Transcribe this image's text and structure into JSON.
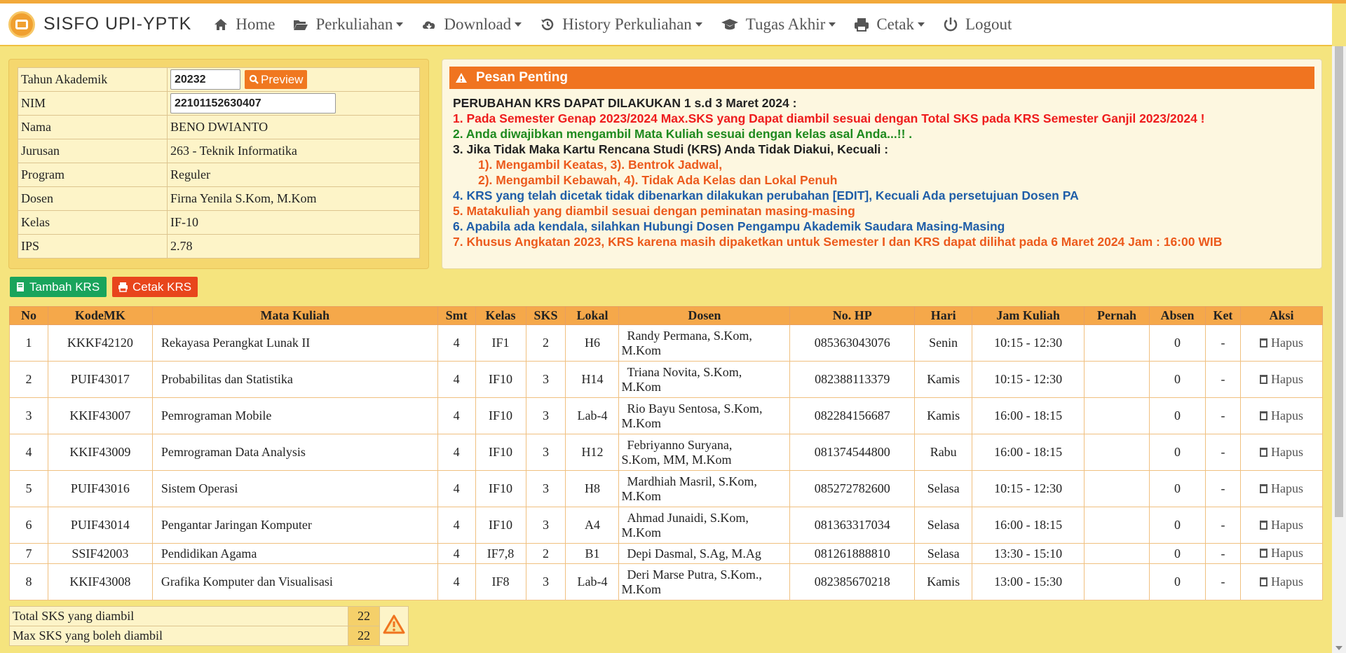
{
  "nav": {
    "brand": "SISFO UPI-YPTK",
    "items": [
      {
        "label": "Home",
        "icon": "home-icon",
        "dropdown": false
      },
      {
        "label": "Perkuliahan",
        "icon": "folder-open-icon",
        "dropdown": true
      },
      {
        "label": "Download",
        "icon": "cloud-download-icon",
        "dropdown": true
      },
      {
        "label": "History Perkuliahan",
        "icon": "history-icon",
        "dropdown": true
      },
      {
        "label": "Tugas Akhir",
        "icon": "graduation-cap-icon",
        "dropdown": true
      },
      {
        "label": "Cetak",
        "icon": "print-icon",
        "dropdown": true
      },
      {
        "label": "Logout",
        "icon": "power-icon",
        "dropdown": false
      }
    ]
  },
  "info": {
    "tahun_label": "Tahun Akademik",
    "tahun_value": "20232",
    "preview_label": "Preview",
    "nim_label": "NIM",
    "nim_value": "22101152630407",
    "nama_label": "Nama",
    "nama_value": "BENO DWIANTO",
    "jurusan_label": "Jurusan",
    "jurusan_value": "263 - Teknik Informatika",
    "program_label": "Program",
    "program_value": "Reguler",
    "dosen_label": "Dosen",
    "dosen_value": "Firna Yenila S.Kom, M.Kom",
    "kelas_label": "Kelas",
    "kelas_value": "IF-10",
    "ips_label": "IPS",
    "ips_value": "2.78"
  },
  "notice": {
    "title": "Pesan Penting",
    "line0": "PERUBAHAN KRS DAPAT DILAKUKAN 1 s.d 3 Maret 2024 :",
    "line1": "1. Pada Semester Genap 2023/2024 Max.SKS yang Dapat diambil sesuai dengan Total SKS pada KRS Semester Ganjil 2023/2024 !",
    "line2": "2. Anda diwajibkan mengambil Mata Kuliah sesuai dengan kelas asal Anda...!! .",
    "line3": "3. Jika Tidak Maka Kartu Rencana Studi (KRS) Anda Tidak Diakui, Kecuali :",
    "line3a": "1). Mengambil Keatas,     3). Bentrok Jadwal,",
    "line3b": "2). Mengambil Kebawah, 4). Tidak Ada Kelas dan Lokal Penuh",
    "line4": "4. KRS yang telah dicetak tidak dibenarkan dilakukan perubahan [EDIT], Kecuali Ada persetujuan Dosen PA",
    "line5": "5. Matakuliah yang diambil sesuai dengan peminatan masing-masing",
    "line6": "6. Apabila ada kendala, silahkan Hubungi Dosen Pengampu Akademik Saudara Masing-Masing",
    "line7": "7. Khusus Angkatan 2023, KRS karena masih dipaketkan untuk Semester I dan KRS dapat dilihat pada 6 Maret 2024 Jam : 16:00 WIB"
  },
  "buttons": {
    "tambah": "Tambah KRS",
    "cetak": "Cetak KRS"
  },
  "table": {
    "headers": [
      "No",
      "KodeMK",
      "Mata Kuliah",
      "Smt",
      "Kelas",
      "SKS",
      "Lokal",
      "Dosen",
      "No. HP",
      "Hari",
      "Jam Kuliah",
      "Pernah",
      "Absen",
      "Ket",
      "Aksi"
    ],
    "action_label": "Hapus",
    "rows": [
      {
        "no": "1",
        "kode": "KKKF42120",
        "mk": "Rekayasa Perangkat Lunak II",
        "smt": "4",
        "kelas": "IF1",
        "sks": "2",
        "lokal": "H6",
        "dosen1": "Randy Permana, S.Kom,",
        "dosen2": "M.Kom",
        "hp": "085363043076",
        "hari": "Senin",
        "jam": "10:15 - 12:30",
        "pernah": "",
        "absen": "0",
        "ket": "-"
      },
      {
        "no": "2",
        "kode": "PUIF43017",
        "mk": "Probabilitas dan Statistika",
        "smt": "4",
        "kelas": "IF10",
        "sks": "3",
        "lokal": "H14",
        "dosen1": "Triana Novita, S.Kom,",
        "dosen2": "M.Kom",
        "hp": "082388113379",
        "hari": "Kamis",
        "jam": "10:15 - 12:30",
        "pernah": "",
        "absen": "0",
        "ket": "-"
      },
      {
        "no": "3",
        "kode": "KKIF43007",
        "mk": "Pemrograman Mobile",
        "smt": "4",
        "kelas": "IF10",
        "sks": "3",
        "lokal": "Lab-4",
        "dosen1": "Rio Bayu Sentosa, S.Kom,",
        "dosen2": "M.Kom",
        "hp": "082284156687",
        "hari": "Kamis",
        "jam": "16:00 - 18:15",
        "pernah": "",
        "absen": "0",
        "ket": "-"
      },
      {
        "no": "4",
        "kode": "KKIF43009",
        "mk": "Pemrograman Data Analysis",
        "smt": "4",
        "kelas": "IF10",
        "sks": "3",
        "lokal": "H12",
        "dosen1": "Febriyanno Suryana,",
        "dosen2": "S.Kom, MM, M.Kom",
        "hp": "081374544800",
        "hari": "Rabu",
        "jam": "16:00 - 18:15",
        "pernah": "",
        "absen": "0",
        "ket": "-"
      },
      {
        "no": "5",
        "kode": "PUIF43016",
        "mk": "Sistem Operasi",
        "smt": "4",
        "kelas": "IF10",
        "sks": "3",
        "lokal": "H8",
        "dosen1": "Mardhiah Masril, S.Kom,",
        "dosen2": "M.Kom",
        "hp": "085272782600",
        "hari": "Selasa",
        "jam": "10:15 - 12:30",
        "pernah": "",
        "absen": "0",
        "ket": "-"
      },
      {
        "no": "6",
        "kode": "PUIF43014",
        "mk": "Pengantar Jaringan Komputer",
        "smt": "4",
        "kelas": "IF10",
        "sks": "3",
        "lokal": "A4",
        "dosen1": "Ahmad Junaidi, S.Kom,",
        "dosen2": "M.Kom",
        "hp": "081363317034",
        "hari": "Selasa",
        "jam": "16:00 - 18:15",
        "pernah": "",
        "absen": "0",
        "ket": "-"
      },
      {
        "no": "7",
        "kode": "SSIF42003",
        "mk": "Pendidikan Agama",
        "smt": "4",
        "kelas": "IF7,8",
        "sks": "2",
        "lokal": "B1",
        "dosen1": "Depi Dasmal, S.Ag, M.Ag",
        "dosen2": "",
        "hp": "081261888810",
        "hari": "Selasa",
        "jam": "13:30 - 15:10",
        "pernah": "",
        "absen": "0",
        "ket": "-"
      },
      {
        "no": "8",
        "kode": "KKIF43008",
        "mk": "Grafika Komputer dan Visualisasi",
        "smt": "4",
        "kelas": "IF8",
        "sks": "3",
        "lokal": "Lab-4",
        "dosen1": "Deri Marse Putra, S.Kom.,",
        "dosen2": "M.Kom",
        "hp": "082385670218",
        "hari": "Kamis",
        "jam": "13:00 - 15:30",
        "pernah": "",
        "absen": "0",
        "ket": "-"
      }
    ]
  },
  "summary": {
    "total_label": "Total SKS yang diambil",
    "total_value": "22",
    "max_label": "Max SKS yang boleh diambil",
    "max_value": "22"
  },
  "colors": {
    "page_bg": "#f5e47e",
    "accent_orange": "#f07420",
    "table_header": "#f5a84a",
    "green_button": "#19a45c",
    "red_button": "#e8451c"
  }
}
